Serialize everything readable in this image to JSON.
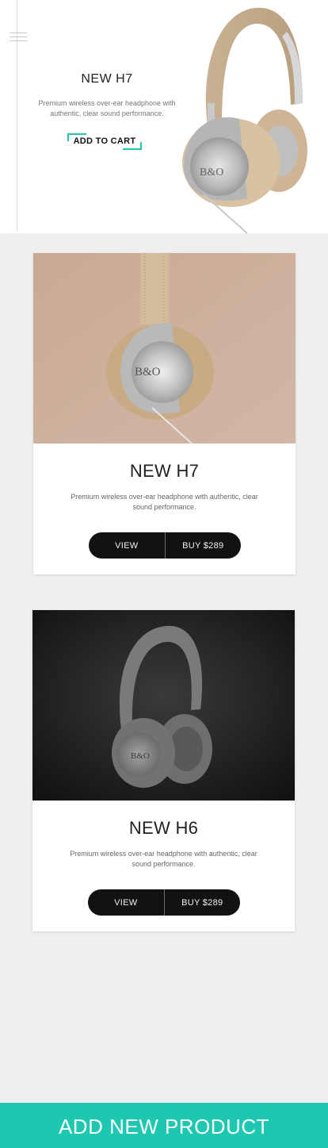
{
  "hero": {
    "title": "NEW H7",
    "description": "Premium wireless over-ear headphone with authentic, clear sound performance.",
    "cta_label": "ADD TO CART",
    "accent": "#1dc7b0"
  },
  "products": [
    {
      "title": "NEW H7",
      "description": "Premium wireless over-ear headphone with authentic, clear sound performance.",
      "view_label": "VIEW",
      "buy_label": "BUY $289",
      "image_bg": "#c9ab98"
    },
    {
      "title": "NEW H6",
      "description": "Premium wireless over-ear headphone with authentic, clear sound performance.",
      "view_label": "VIEW",
      "buy_label": "BUY $289",
      "image_bg": "#1c1c1c"
    }
  ],
  "footer": {
    "add_product_label": "ADD NEW PRODUCT",
    "color": "#1dc7b0"
  }
}
